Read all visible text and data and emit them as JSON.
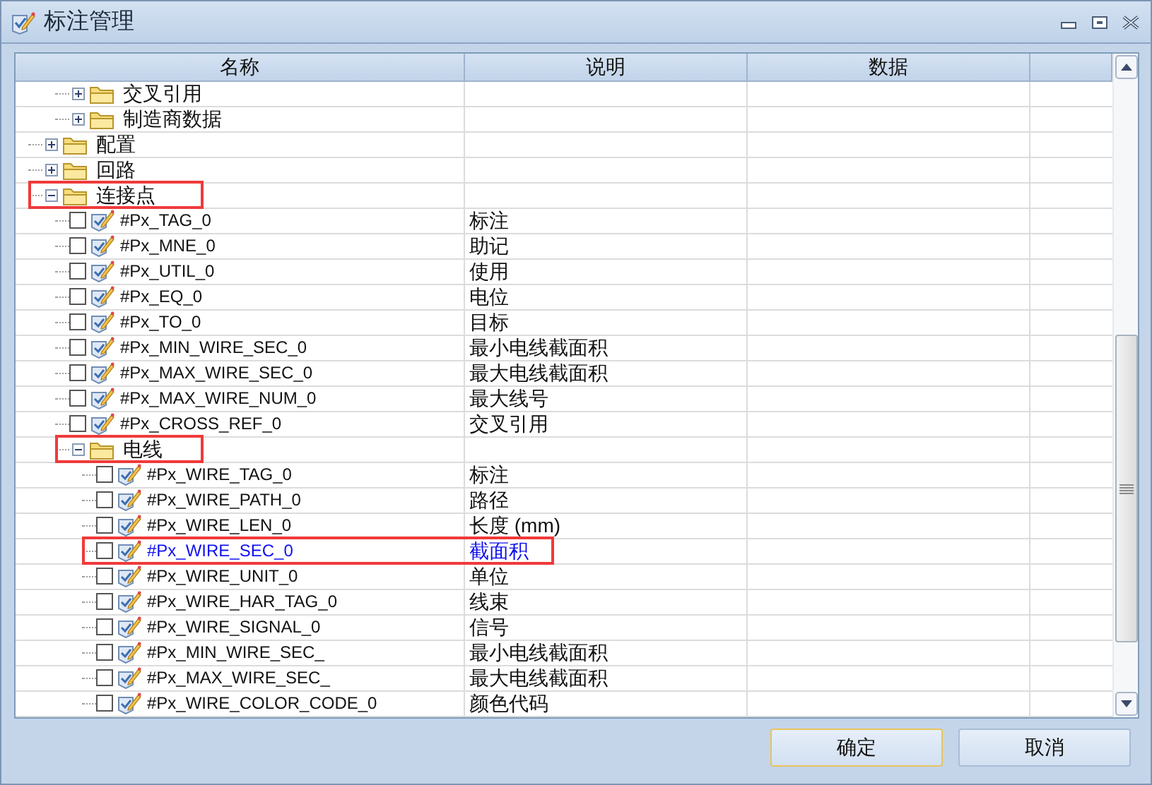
{
  "window": {
    "title": "标注管理"
  },
  "table": {
    "columns": [
      "名称",
      "说明",
      "数据"
    ],
    "tree": [
      {
        "kind": "group",
        "children": [
          {
            "kind": "folder",
            "label": "交叉引用",
            "expanded": false,
            "marked": false
          },
          {
            "kind": "folder",
            "label": "制造商数据",
            "expanded": false,
            "marked": false
          }
        ]
      },
      {
        "kind": "folder",
        "label": "配置",
        "expanded": false,
        "marked": false
      },
      {
        "kind": "folder",
        "label": "回路",
        "expanded": false,
        "marked": false
      },
      {
        "kind": "folder",
        "label": "连接点",
        "expanded": true,
        "marked": true,
        "children": [
          {
            "kind": "field",
            "label": "#Px_TAG_0",
            "description": "标注",
            "checked": false,
            "selected": false,
            "marked": false
          },
          {
            "kind": "field",
            "label": "#Px_MNE_0",
            "description": "助记",
            "checked": false,
            "selected": false,
            "marked": false
          },
          {
            "kind": "field",
            "label": "#Px_UTIL_0",
            "description": "使用",
            "checked": false,
            "selected": false,
            "marked": false
          },
          {
            "kind": "field",
            "label": "#Px_EQ_0",
            "description": "电位",
            "checked": false,
            "selected": false,
            "marked": false
          },
          {
            "kind": "field",
            "label": "#Px_TO_0",
            "description": "目标",
            "checked": false,
            "selected": false,
            "marked": false
          },
          {
            "kind": "field",
            "label": "#Px_MIN_WIRE_SEC_0",
            "description": "最小电线截面积",
            "checked": false,
            "selected": false,
            "marked": false
          },
          {
            "kind": "field",
            "label": "#Px_MAX_WIRE_SEC_0",
            "description": "最大电线截面积",
            "checked": false,
            "selected": false,
            "marked": false
          },
          {
            "kind": "field",
            "label": "#Px_MAX_WIRE_NUM_0",
            "description": "最大线号",
            "checked": false,
            "selected": false,
            "marked": false
          },
          {
            "kind": "field",
            "label": "#Px_CROSS_REF_0",
            "description": "交叉引用",
            "checked": false,
            "selected": false,
            "marked": false
          },
          {
            "kind": "folder",
            "label": "电线",
            "expanded": true,
            "marked": true,
            "children": [
              {
                "kind": "field",
                "label": "#Px_WIRE_TAG_0",
                "description": "标注",
                "checked": false,
                "selected": false,
                "marked": false
              },
              {
                "kind": "field",
                "label": "#Px_WIRE_PATH_0",
                "description": "路径",
                "checked": false,
                "selected": false,
                "marked": false
              },
              {
                "kind": "field",
                "label": "#Px_WIRE_LEN_0",
                "description": "长度 (mm)",
                "checked": false,
                "selected": false,
                "marked": false
              },
              {
                "kind": "field",
                "label": "#Px_WIRE_SEC_0",
                "description": "截面积",
                "checked": false,
                "selected": true,
                "marked": true
              },
              {
                "kind": "field",
                "label": "#Px_WIRE_UNIT_0",
                "description": "单位",
                "checked": false,
                "selected": false,
                "marked": false
              },
              {
                "kind": "field",
                "label": "#Px_WIRE_HAR_TAG_0",
                "description": "线束",
                "checked": false,
                "selected": false,
                "marked": false
              },
              {
                "kind": "field",
                "label": "#Px_WIRE_SIGNAL_0",
                "description": "信号",
                "checked": false,
                "selected": false,
                "marked": false
              },
              {
                "kind": "field",
                "label": "#Px_MIN_WIRE_SEC_",
                "description": "最小电线截面积",
                "checked": false,
                "selected": false,
                "marked": false
              },
              {
                "kind": "field",
                "label": "#Px_MAX_WIRE_SEC_",
                "description": "最大电线截面积",
                "checked": false,
                "selected": false,
                "marked": false
              },
              {
                "kind": "field",
                "label": "#Px_WIRE_COLOR_CODE_0",
                "description": "颜色代码",
                "checked": false,
                "selected": false,
                "marked": false
              }
            ]
          }
        ]
      }
    ]
  },
  "buttons": [
    "确定",
    "取消"
  ]
}
